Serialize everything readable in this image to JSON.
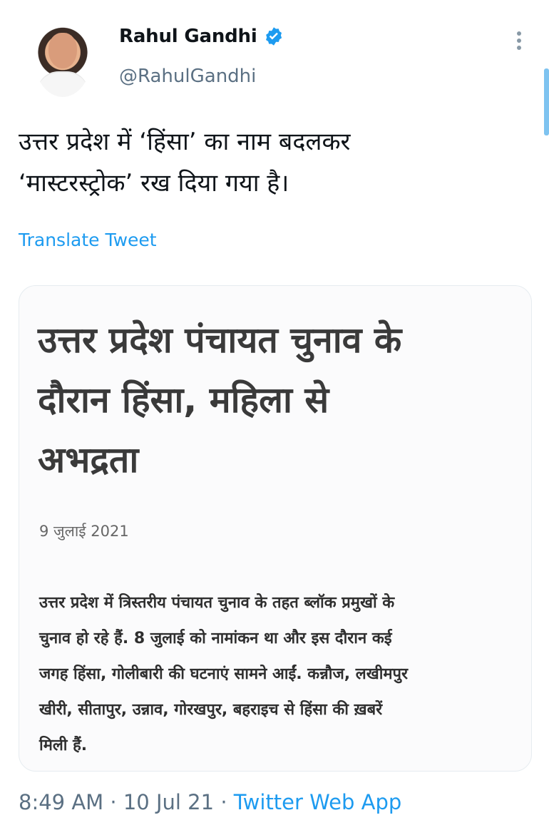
{
  "author": {
    "display_name": "Rahul Gandhi",
    "handle": "@RahulGandhi",
    "verified": true
  },
  "tweet": {
    "text": "उत्तर प्रदेश में ‘हिंसा’ का नाम बदलकर\n‘मास्टरस्ट्रोक’ रख दिया गया है।",
    "translate_label": "Translate Tweet"
  },
  "card": {
    "headline": "उत्तर प्रदेश पंचायत चुनाव के\nदौरान हिंसा, महिला से\nअभद्रता",
    "date": "9 जुलाई 2021",
    "body": "उत्तर प्रदेश में त्रिस्तरीय पंचायत चुनाव के तहत ब्लॉक प्रमुखों के\nचुनाव हो रहे हैं. 8 जुलाई को नामांकन था और इस दौरान कई\nजगह हिंसा, गोलीबारी की घटनाएं सामने आईं. कन्नौज, लखीमपुर\nखीरी, सीतापुर, उन्नाव, गोरखपुर, बहराइच से हिंसा की ख़बरें\nमिली हैं."
  },
  "meta": {
    "time": "8:49 AM",
    "separator": "·",
    "date": "10 Jul 21",
    "source": "Twitter Web App"
  },
  "colors": {
    "accent": "#1d9bf0",
    "secondary_text": "#5b7083"
  },
  "icons": {
    "verified": "verified-badge-icon",
    "more": "more-options-icon"
  }
}
